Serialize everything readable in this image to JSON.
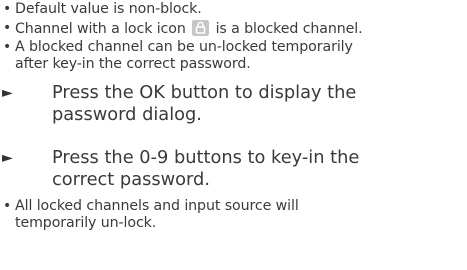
{
  "bullets_top": [
    {
      "text": "Default value is non-block."
    },
    {
      "text_before": "Channel with a lock icon",
      "icon": "lock-icon",
      "text_after": "is a blocked channel."
    },
    {
      "line1": "A blocked channel can be un-locked temporarily",
      "line2": "after key-in the correct password."
    }
  ],
  "steps": [
    {
      "marker": "►",
      "line1": "Press the OK button to display the",
      "line2": "password dialog."
    },
    {
      "marker": "►",
      "line1": "Press the 0-9 buttons to key-in the",
      "line2": "correct password."
    }
  ],
  "bullets_bottom": [
    {
      "line1": "All locked channels and input source will",
      "line2": "temporarily un-lock."
    }
  ],
  "bullet_marker": "•",
  "colors": {
    "text": "#3a3a3a",
    "icon_bg": "#c6c6c6",
    "icon_fg": "#ffffff"
  }
}
